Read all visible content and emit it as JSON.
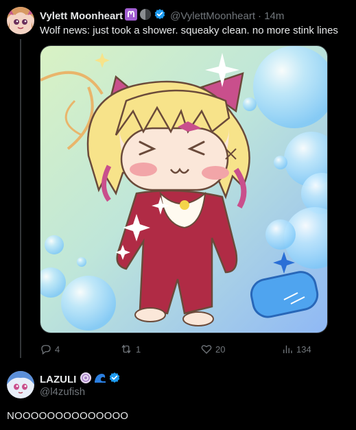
{
  "tweet": {
    "author_name": "Vylett Moonheart",
    "author_emojis": [
      "aries-icon",
      "moon-icon"
    ],
    "handle": "@VylettMoonheart",
    "time": "· 14m",
    "text": "Wolf news: just took a shower. squeaky clean. no more stink lines",
    "media_description": "chibi-wolf-girl-illustration",
    "stats": {
      "replies": "4",
      "reposts": "1",
      "likes": "20",
      "views": "134"
    }
  },
  "reply": {
    "author_name": "LAZULI",
    "author_emojis": [
      "flower-icon",
      "wave-icon"
    ],
    "handle": "@l4zufish",
    "text": "NOOOOOOOOOOOOOO"
  },
  "colors": {
    "background": "#000000",
    "text_primary": "#e7e9ea",
    "text_secondary": "#71767b",
    "verified": "#1d9bf0",
    "divider": "#333639"
  }
}
